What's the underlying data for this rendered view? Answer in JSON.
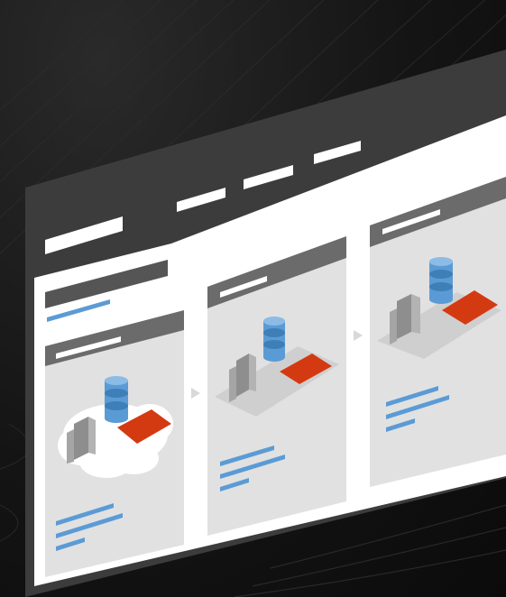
{
  "illustration": {
    "subject": "",
    "colors": {
      "background": "#141414",
      "window_frame": "#3c3c3c",
      "window_body": "#ffffff",
      "panel": "#e1e1e1",
      "panel_header": "#6b6b6b",
      "placeholder_line": "#ffffff",
      "text_line": "#5b9bd5",
      "database": "#5b9bd5",
      "building": "#9a9a9a",
      "tile": "#d43a12"
    },
    "icons": [
      "database-icon",
      "building-icon",
      "tile-icon",
      "cloud-icon",
      "arrow-right-icon"
    ]
  }
}
